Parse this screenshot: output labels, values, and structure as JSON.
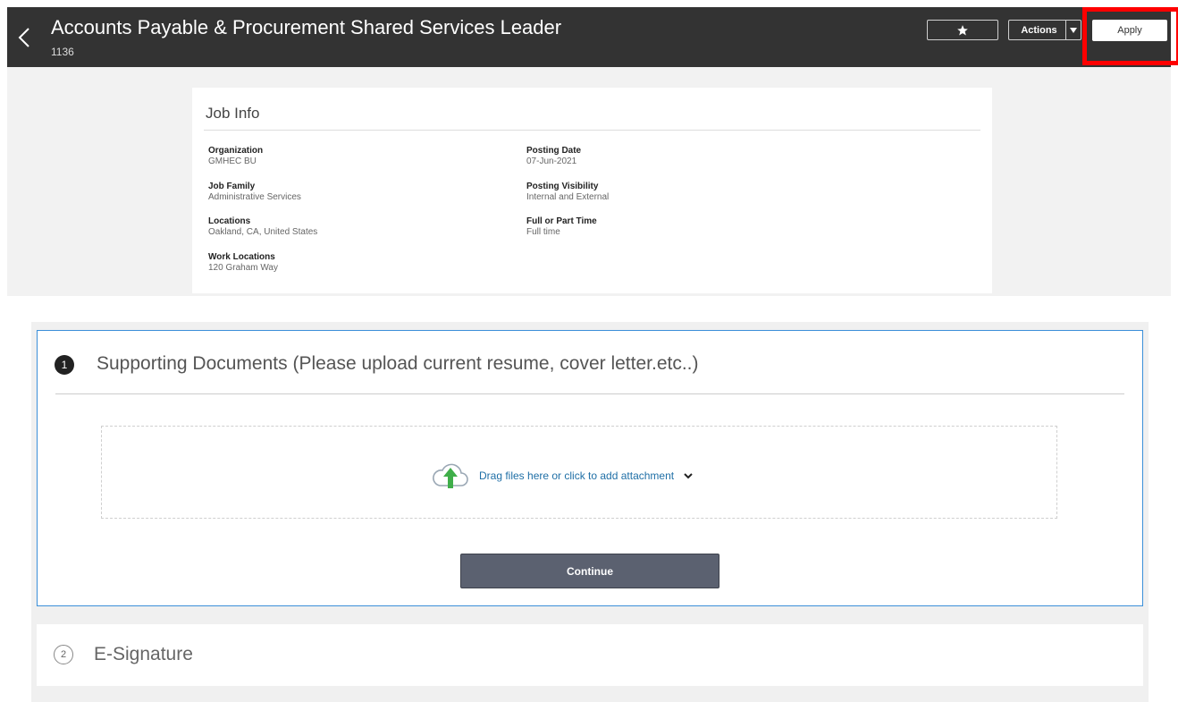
{
  "header": {
    "title": "Accounts Payable & Procurement Shared Services Leader",
    "job_id": "1136",
    "actions_label": "Actions",
    "apply_label": "Apply",
    "icons": {
      "back": "chevron-left-icon",
      "favorite": "star-icon",
      "actions_caret": "caret-down-icon"
    },
    "highlight_color": "#ff0000"
  },
  "job_info": {
    "title": "Job Info",
    "fields": [
      {
        "label": "Organization",
        "value": "GMHEC BU"
      },
      {
        "label": "Job Family",
        "value": "Administrative Services"
      },
      {
        "label": "Locations",
        "value": "Oakland, CA, United States"
      },
      {
        "label": "Work Locations",
        "value": "120 Graham Way"
      },
      {
        "label": "Posting Date",
        "value": "07-Jun-2021"
      },
      {
        "label": "Posting Visibility",
        "value": "Internal and External"
      },
      {
        "label": "Full or Part Time",
        "value": "Full time"
      }
    ]
  },
  "steps": {
    "step1": {
      "number": "1",
      "title": "Supporting Documents (Please upload current resume, cover letter.etc..)",
      "dropzone_text": "Drag files here or click to add attachment",
      "continue_label": "Continue",
      "accent_color": "#3b8fd9"
    },
    "step2": {
      "number": "2",
      "title": "E-Signature"
    }
  }
}
